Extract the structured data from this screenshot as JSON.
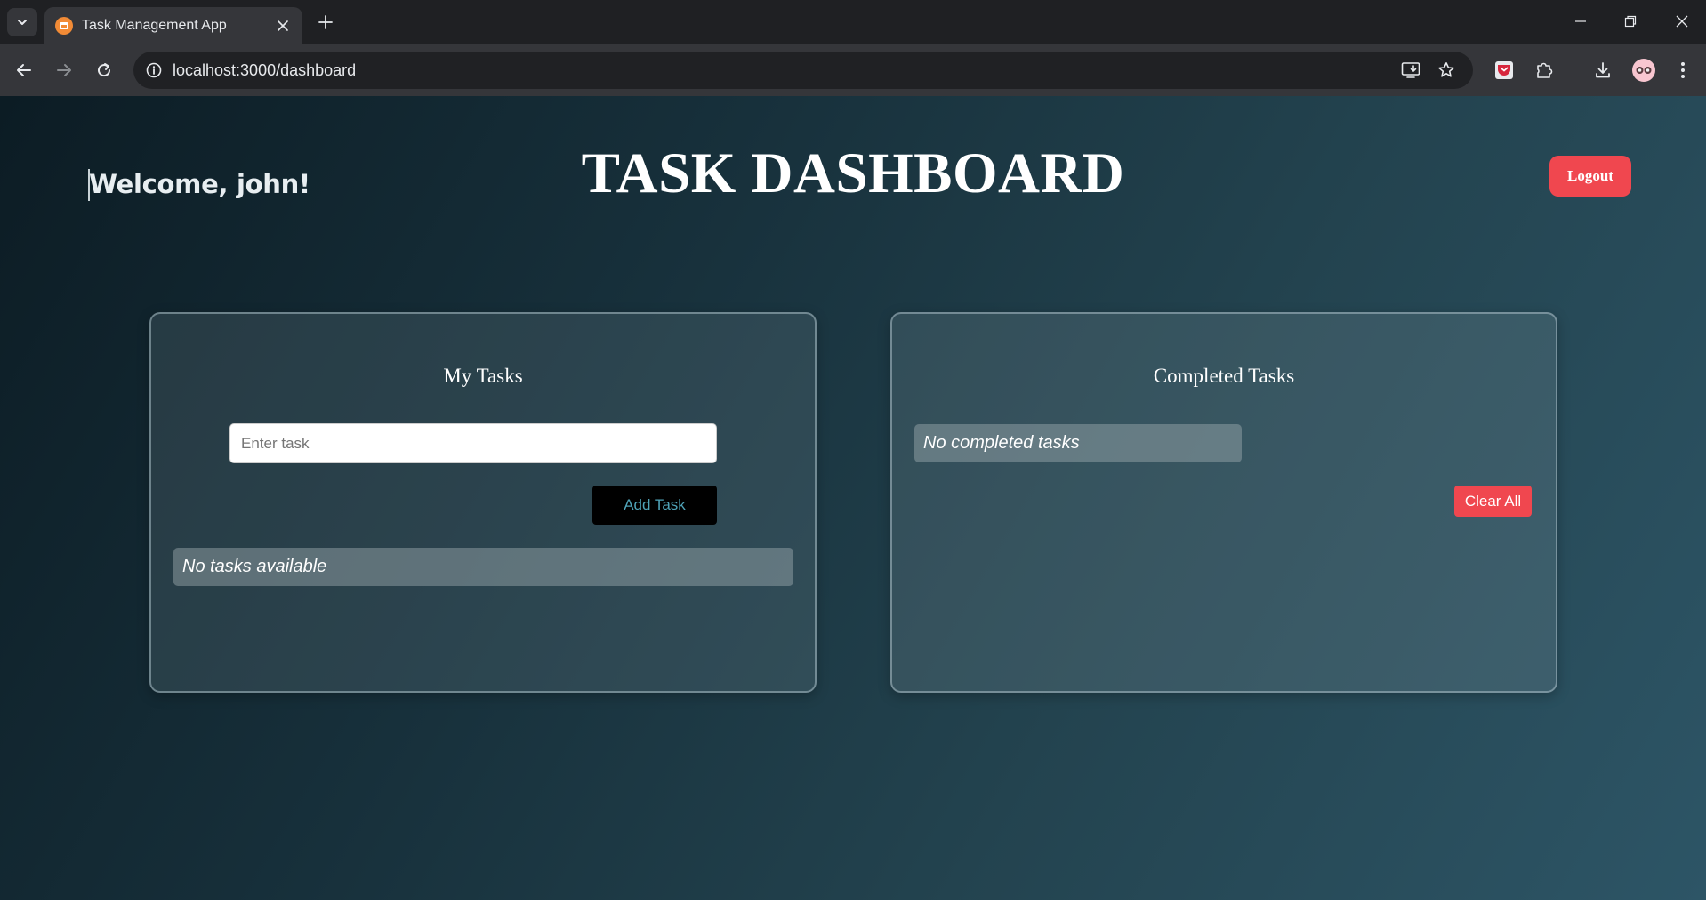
{
  "browser": {
    "tab_title": "Task Management App",
    "url": "localhost:3000/dashboard"
  },
  "page": {
    "welcome": "Welcome, john!",
    "title": "TASK DASHBOARD",
    "logout_label": "Logout",
    "accent_color": "#f0474f"
  },
  "my_tasks": {
    "heading": "My Tasks",
    "input_placeholder": "Enter task",
    "input_value": "",
    "add_label": "Add Task",
    "empty_message": "No tasks available"
  },
  "completed_tasks": {
    "heading": "Completed Tasks",
    "empty_message": "No completed tasks",
    "clear_label": "Clear All"
  }
}
